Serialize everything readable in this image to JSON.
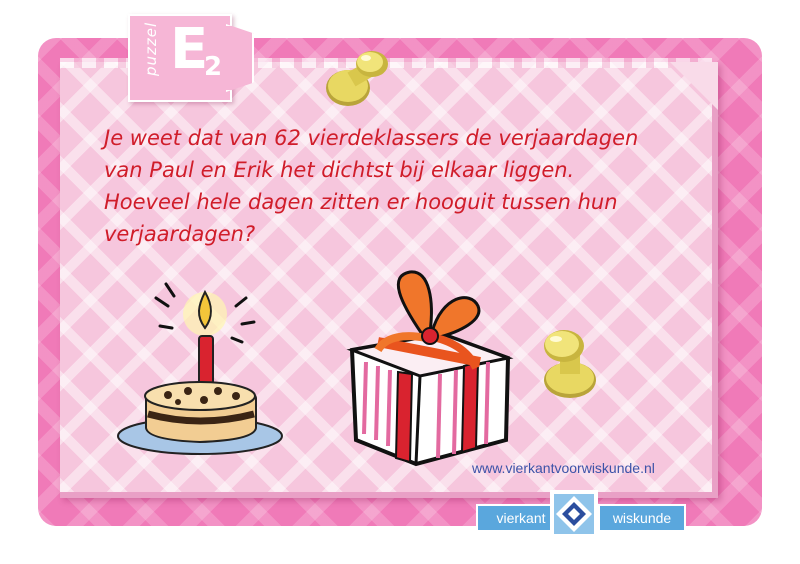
{
  "tab": {
    "small_label": "puzzel",
    "letter": "E",
    "number": "2"
  },
  "question": {
    "lines": [
      "Je weet dat van 62 vierdeklassers de verjaardagen",
      "van Paul en Erik het dichtst bij elkaar liggen.",
      "Hoeveel hele dagen zitten er hooguit tussen hun",
      "verjaardagen?"
    ]
  },
  "footer": {
    "website": "www.vierkantvoorwiskunde.nl",
    "logo_left": "vierkant",
    "logo_right": "wiskunde"
  },
  "colors": {
    "card": "#f07ab8",
    "paper": "#f6c6dd",
    "question_text": "#d01d2a",
    "logo": "#5aa7dd",
    "website_text": "#3c53a8"
  },
  "icons": [
    "pushpin-icon",
    "birthday-cake-icon",
    "gift-box-icon",
    "vierkant-logo-icon"
  ]
}
